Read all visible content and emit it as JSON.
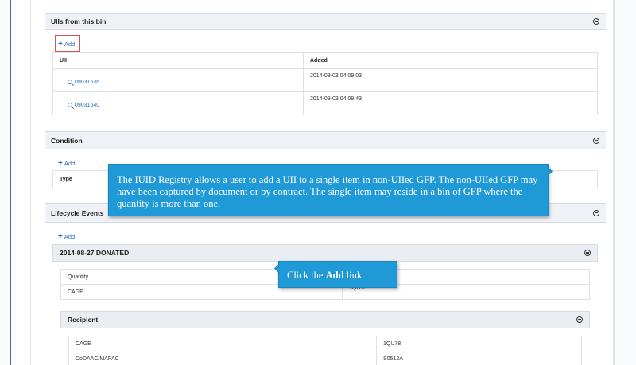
{
  "uiis_panel": {
    "title": "UIIs from this bin",
    "add_label": "Add",
    "columns": [
      "UII",
      "Added"
    ],
    "rows": [
      {
        "uii": "09031636",
        "added": "2014-09-03 04:09:03"
      },
      {
        "uii": "09031640",
        "added": "2014-09-03 04:09:43"
      }
    ]
  },
  "condition_panel": {
    "title": "Condition",
    "add_label": "Add",
    "type_label": "Type"
  },
  "lifecycle_panel": {
    "title": "Lifecycle Events",
    "add_label": "Add",
    "event": {
      "title": "2014-08-27 DONATED",
      "quantity_label": "Quantity",
      "cage_label": "CAGE",
      "cage_value": "1QU78"
    },
    "recipient": {
      "title": "Recipient",
      "cage_label": "CAGE",
      "cage_value": "1QU78",
      "dodaac_label": "DoDAAC/MAPAC",
      "dodaac_value": "S0512A"
    }
  },
  "callouts": {
    "main_text": "The IUID Registry allows a user to add a UII to a single item in non-UIIed GFP. The non-UIIed GFP may have been captured by document or by contract. The single item may reside in a bin of GFP where the quantity is more than one.",
    "instruction_prefix": "Click the ",
    "instruction_bold": "Add",
    "instruction_suffix": " link."
  }
}
